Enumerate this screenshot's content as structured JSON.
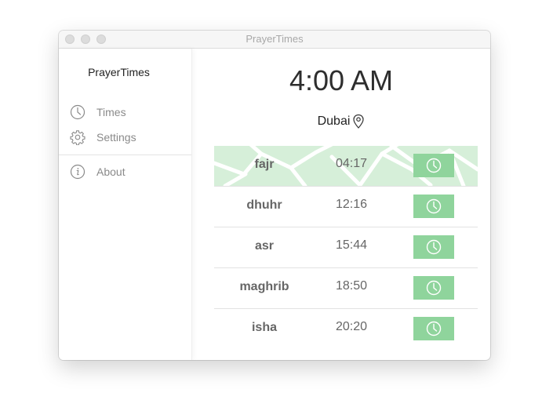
{
  "window": {
    "title": "PrayerTimes"
  },
  "sidebar": {
    "title": "PrayerTimes",
    "items": [
      {
        "label": "Times",
        "icon": "clock-icon"
      },
      {
        "label": "Settings",
        "icon": "gear-icon"
      },
      {
        "label": "About",
        "icon": "info-icon"
      }
    ]
  },
  "main": {
    "current_time": "4:00 AM",
    "location": "Dubai",
    "prayers": [
      {
        "name": "fajr",
        "time": "04:17",
        "active": true
      },
      {
        "name": "dhuhr",
        "time": "12:16",
        "active": false
      },
      {
        "name": "asr",
        "time": "15:44",
        "active": false
      },
      {
        "name": "maghrib",
        "time": "18:50",
        "active": false
      },
      {
        "name": "isha",
        "time": "20:20",
        "active": false
      }
    ]
  },
  "colors": {
    "accent_green": "#8fd49c",
    "active_row": "#d6efd9",
    "muted_text": "#8a8a8a"
  }
}
